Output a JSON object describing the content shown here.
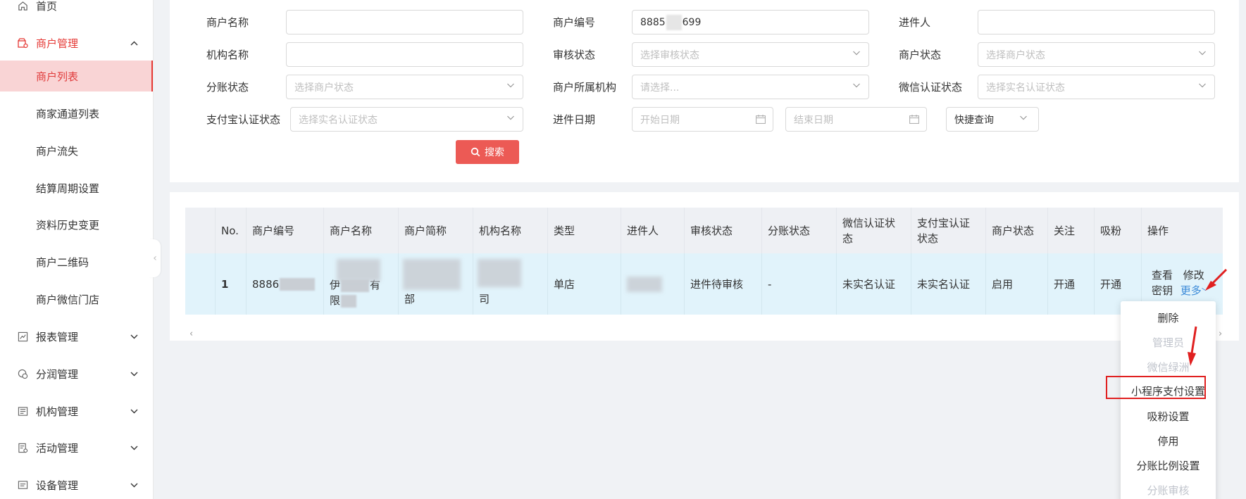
{
  "sidebar": {
    "home": "首页",
    "merchant_mgmt": "商户管理",
    "merchant_list": "商户列表",
    "channel_list": "商家通道列表",
    "merchant_churn": "商户流失",
    "settle_cycle": "结算周期设置",
    "data_history": "资料历史变更",
    "merchant_qrcode": "商户二维码",
    "wechat_store": "商户微信门店",
    "report_mgmt": "报表管理",
    "profit_mgmt": "分润管理",
    "org_mgmt": "机构管理",
    "activity_mgmt": "活动管理",
    "device_mgmt": "设备管理"
  },
  "filters": {
    "merchant_name_label": "商户名称",
    "merchant_no_label": "商户编号",
    "merchant_no_prefix": "8885",
    "merchant_no_suffix": "699",
    "applicant_label": "进件人",
    "org_name_label": "机构名称",
    "audit_status_label": "审核状态",
    "audit_status_placeholder": "选择审核状态",
    "merchant_status_label": "商户状态",
    "merchant_status_placeholder": "选择商户状态",
    "split_status_label": "分账状态",
    "split_status_placeholder": "选择商户状态",
    "merchant_org_label": "商户所属机构",
    "merchant_org_placeholder": "请选择...",
    "wechat_auth_label": "微信认证状态",
    "wechat_auth_placeholder": "选择实名认证状态",
    "alipay_auth_label": "支付宝认证状态",
    "alipay_auth_placeholder": "选择实名认证状态",
    "entry_date_label": "进件日期",
    "start_date_placeholder": "开始日期",
    "end_date_placeholder": "结束日期",
    "quick_query": "快捷查询",
    "search_button": "搜索"
  },
  "table": {
    "headers": [
      "No.",
      "商户编号",
      "商户名称",
      "商户简称",
      "机构名称",
      "类型",
      "进件人",
      "审核状态",
      "分账状态",
      "微信认证状态",
      "支付宝认证状态",
      "商户状态",
      "关注",
      "吸粉",
      "操作"
    ],
    "row": {
      "no": "1",
      "merchant_no": "8886",
      "merchant_name_line2": "伊",
      "merchant_name_line2b": "有",
      "merchant_name_line3": "限",
      "merchant_short_line3": "部",
      "org_name_line3": "司",
      "type": "单店",
      "audit_status": "进件待审核",
      "split_status": "-",
      "wechat_auth": "未实名认证",
      "alipay_auth": "未实名认证",
      "merchant_status": "启用",
      "follow": "开通",
      "fans": "开通",
      "op_view": "查看",
      "op_edit": "修改",
      "op_secret": "密钥",
      "op_more": "更多"
    }
  },
  "dropdown": {
    "items": [
      {
        "label": "删除",
        "disabled": false
      },
      {
        "label": "管理员",
        "disabled": true
      },
      {
        "label": "微信绿洲",
        "disabled": true
      },
      {
        "label": "小程序支付设置",
        "disabled": false
      },
      {
        "label": "吸粉设置",
        "disabled": false
      },
      {
        "label": "停用",
        "disabled": false
      },
      {
        "label": "分账比例设置",
        "disabled": false
      },
      {
        "label": "分账审核",
        "disabled": true
      }
    ]
  },
  "colors": {
    "accent": "#e53935",
    "active_bg": "#f9d4d5",
    "search_btn": "#ec5a55",
    "link_blue": "#3d8bd8",
    "row_highlight": "#e1f3fb"
  }
}
